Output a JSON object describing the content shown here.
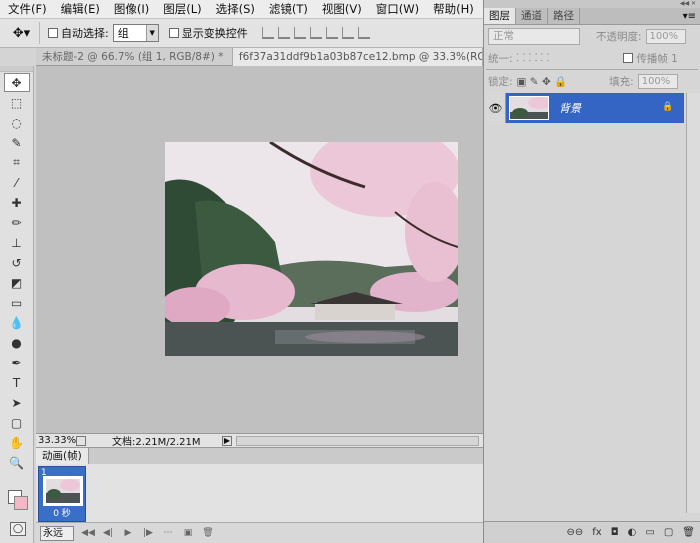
{
  "menu": {
    "items": [
      "文件(F)",
      "编辑(E)",
      "图像(I)",
      "图层(L)",
      "选择(S)",
      "滤镜(T)",
      "视图(V)",
      "窗口(W)",
      "帮助(H)"
    ]
  },
  "options": {
    "auto_select_label": "自动选择:",
    "auto_select_value": "组",
    "show_transform_label": "显示变换控件"
  },
  "tabs": [
    {
      "label": "未标题-2 @ 66.7% (组 1, RGB/8#) *",
      "close": "×"
    },
    {
      "label": "f6f37a31ddf9b1a03b87ce12.bmp @ 33.3%(RGB/"
    }
  ],
  "status": {
    "zoom": "33.33%",
    "doc_info": "文档:2.21M/2.21M"
  },
  "animation": {
    "tab_label": "动画(帧)",
    "frame_number": "1",
    "frame_delay": "0 秒",
    "loop": "永远"
  },
  "layers_panel": {
    "tabs": [
      "图层",
      "通道",
      "路径"
    ],
    "blend_mode": "正常",
    "opacity_label": "不透明度:",
    "opacity_value": "100%",
    "unify_label": "统一:",
    "propagate_label": "传播帧 1",
    "lock_label": "锁定:",
    "fill_label": "填充:",
    "fill_value": "100%",
    "layer_name": "背景"
  },
  "colors": {
    "selection_blue": "#3465c5",
    "background_swatch": "#f2b8c6",
    "foreground_swatch": "#ffffff"
  }
}
